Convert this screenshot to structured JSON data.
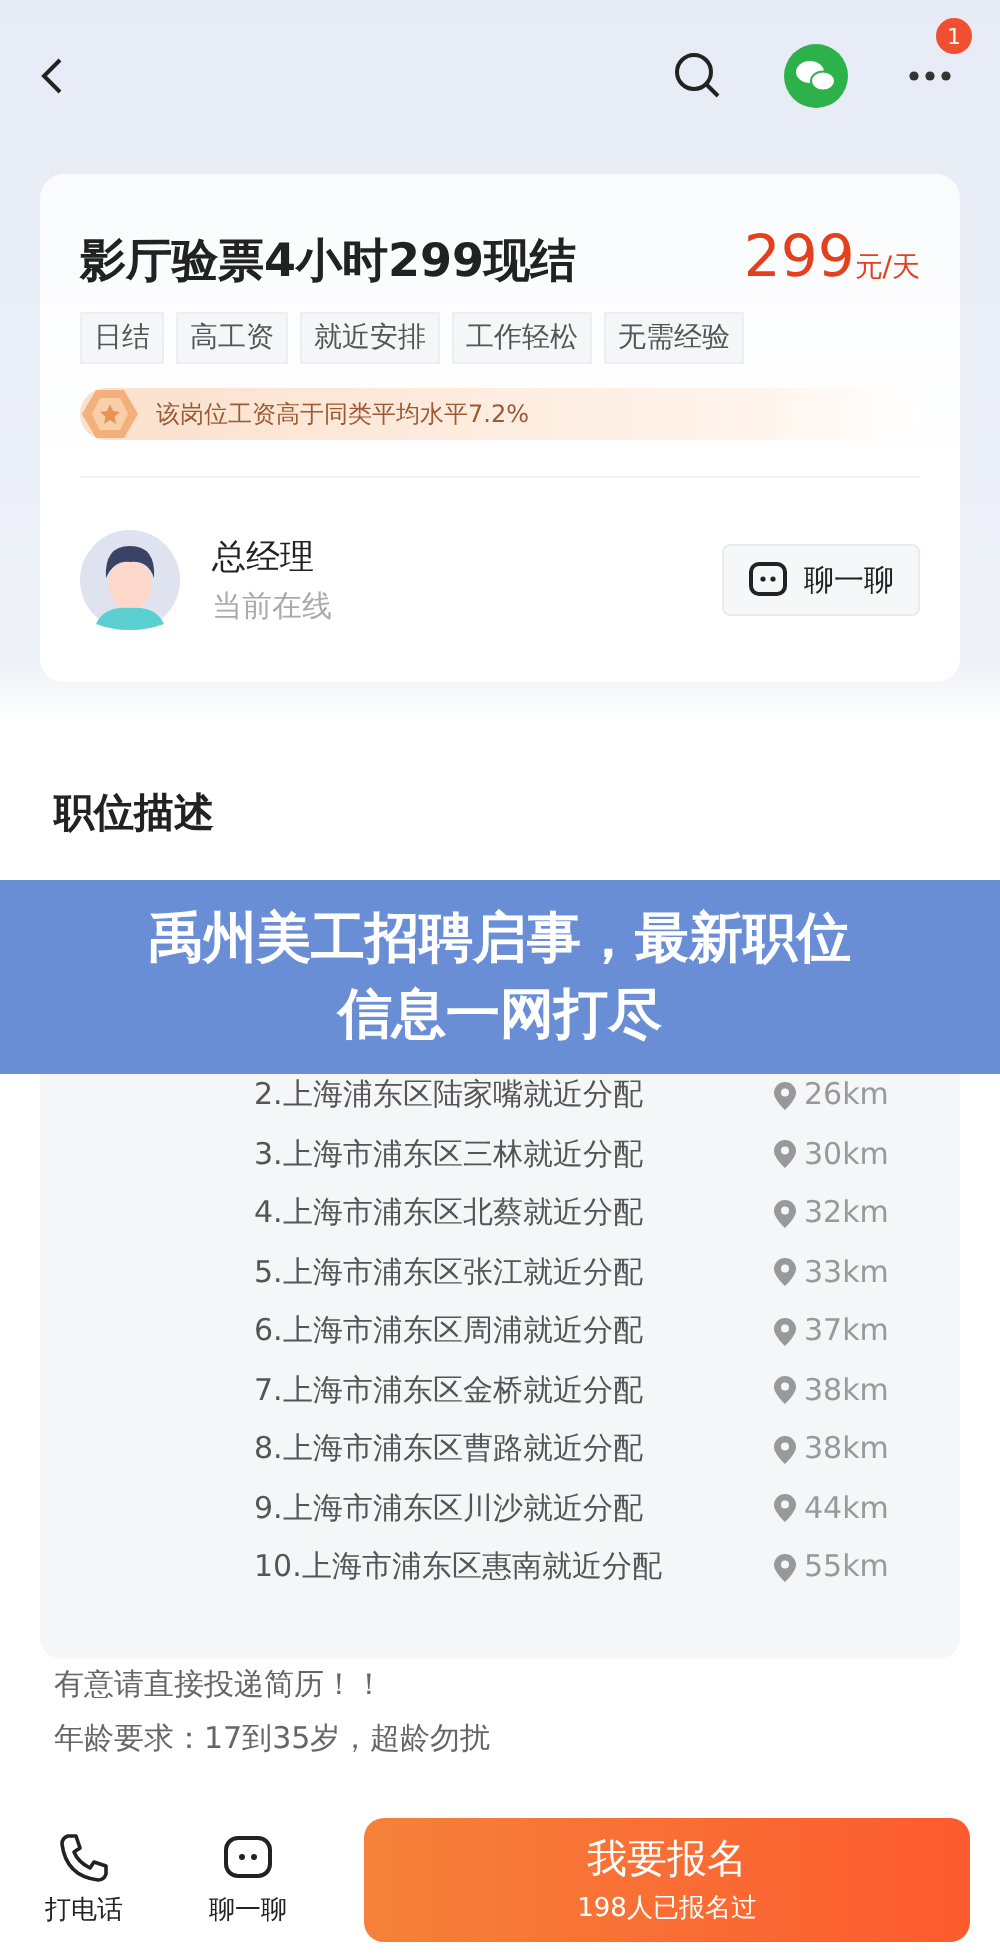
{
  "top_bar": {
    "notification_badge": "1"
  },
  "job": {
    "title": "影厅验票4小时299现结",
    "salary": "299",
    "salary_unit": "元/天",
    "tags": [
      "日结",
      "高工资",
      "就近安排",
      "工作轻松",
      "无需经验"
    ],
    "salary_note": "该岗位工资高于同类平均水平7.2%"
  },
  "recruiter": {
    "name": "总经理",
    "status": "当前在线",
    "chat_button": "聊一聊"
  },
  "description": {
    "heading": "职位描述",
    "details": [
      {
        "values": [
          {
            "text": "2.上海浦东区陆家嘴就近分配",
            "distance": "26km"
          },
          {
            "text": "3.上海市浦东区三林就近分配",
            "distance": "30km"
          },
          {
            "text": "4.上海市浦东区北蔡就近分配",
            "distance": "32km"
          },
          {
            "text": "5.上海市浦东区张江就近分配",
            "distance": "33km"
          },
          {
            "text": "6.上海市浦东区周浦就近分配",
            "distance": "37km"
          },
          {
            "text": "7.上海市浦东区金桥就近分配",
            "distance": "38km"
          },
          {
            "text": "8.上海市浦东区曹路就近分配",
            "distance": "38km"
          },
          {
            "text": "9.上海市浦东区川沙就近分配",
            "distance": "44km"
          },
          {
            "text": "10.上海市浦东区惠南就近分配",
            "distance": "55km"
          }
        ]
      }
    ],
    "notes": [
      "有意请直接投递简历！！",
      "年龄要求：17到35岁，超龄勿扰"
    ]
  },
  "overlay_banner": {
    "title": "禹州美工招聘启事，最新职位信息一网打尽"
  },
  "bottom_bar": {
    "actions": [
      {
        "kind": "phone",
        "label": "打电话"
      },
      {
        "kind": "chat",
        "label": "聊一聊"
      }
    ],
    "apply_button": {
      "label": "我要报名",
      "subtitle": "198人已报名过"
    }
  }
}
